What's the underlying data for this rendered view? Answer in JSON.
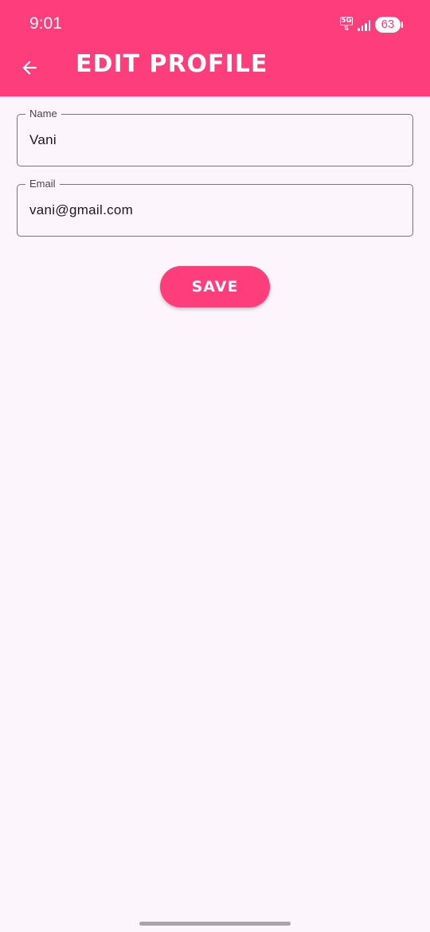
{
  "status_bar": {
    "time": "9:01",
    "network": "5G",
    "battery": "63"
  },
  "app_bar": {
    "title": "EDIT PROFILE",
    "back_icon": "arrow-back-icon"
  },
  "form": {
    "name": {
      "label": "Name",
      "value": "Vani"
    },
    "email": {
      "label": "Email",
      "value": "vani@gmail.com"
    }
  },
  "actions": {
    "save_label": "SAVE"
  },
  "colors": {
    "accent": "#fe3d7d",
    "background": "#fcf6fc",
    "outline": "#7a757b"
  }
}
